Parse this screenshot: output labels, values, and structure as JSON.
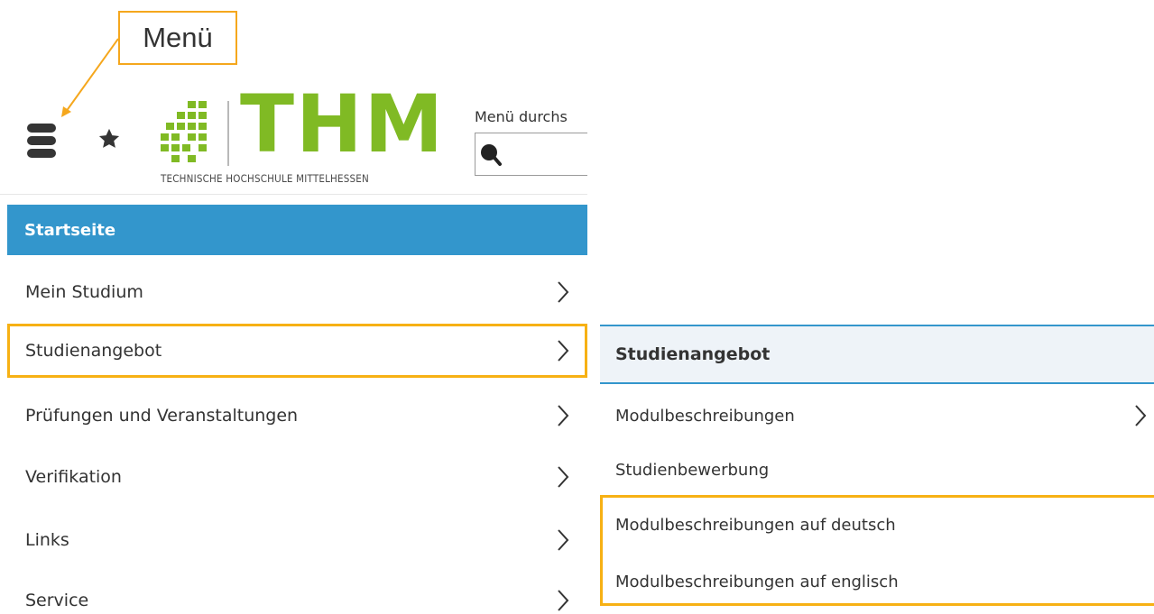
{
  "annotation": {
    "label": "Menü"
  },
  "header": {
    "logo_text": "THM",
    "logo_subtitle": "TECHNISCHE HOCHSCHULE MITTELHESSEN",
    "search_label": "Menü durchs",
    "search_value": ""
  },
  "menu": {
    "home": "Startseite",
    "items": [
      {
        "label": "Mein Studium"
      },
      {
        "label": "Studienangebot"
      },
      {
        "label": "Prüfungen und Veranstaltungen"
      },
      {
        "label": "Verifikation"
      },
      {
        "label": "Links"
      },
      {
        "label": "Service"
      }
    ]
  },
  "submenu": {
    "title": "Studienangebot",
    "items": [
      {
        "label": "Modulbeschreibungen"
      },
      {
        "label": "Studienbewerbung"
      },
      {
        "label": "Modulbeschreibungen auf deutsch"
      },
      {
        "label": "Modulbeschreibungen auf englisch"
      }
    ]
  },
  "colors": {
    "accent_blue": "#3396cc",
    "thm_green": "#80ba24",
    "highlight_orange": "#f7b114"
  }
}
